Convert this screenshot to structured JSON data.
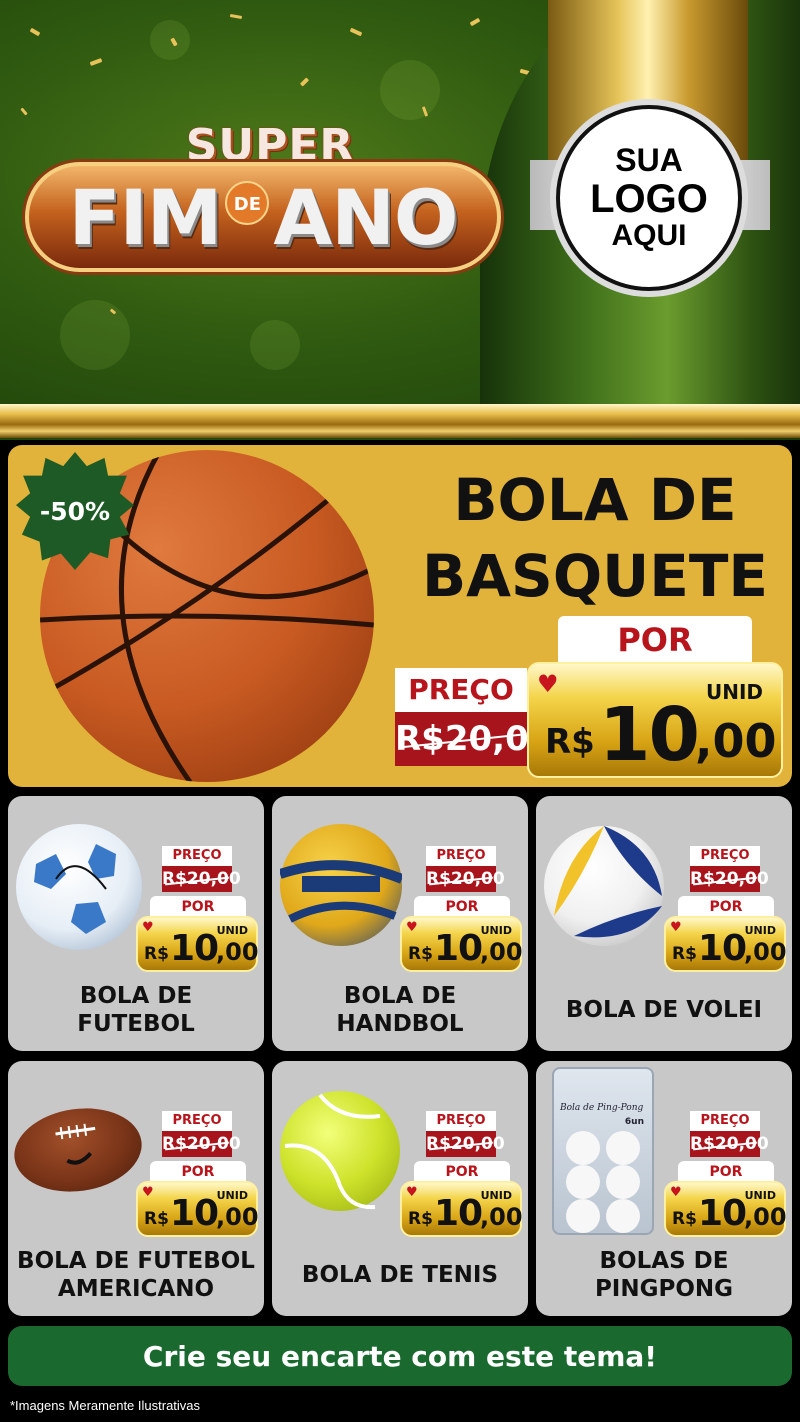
{
  "header": {
    "title_super": "SUPER",
    "title_fim": "FIM",
    "title_de": "DE",
    "title_ano": "ANO",
    "logo_line1": "SUA",
    "logo_line2": "LOGO",
    "logo_line3": "AQUI"
  },
  "featured": {
    "badge": "-50%",
    "name_line1": "BOLA DE",
    "name_line2": "BASQUETE",
    "por_label": "POR",
    "preco_label": "PREÇO",
    "old_price": "R$20,00",
    "unit": "UNID",
    "currency": "R$",
    "price_int": "10",
    "price_dec": ",00"
  },
  "products": [
    {
      "name_line1": "BOLA DE",
      "name_line2": "FUTEBOL",
      "image": "soccer-ball",
      "preco_label": "PREÇO",
      "old_price": "R$20,00",
      "por_label": "POR",
      "unit": "UNID",
      "currency": "R$",
      "price_int": "10",
      "price_dec": ",00"
    },
    {
      "name_line1": "BOLA DE",
      "name_line2": "HANDBOL",
      "image": "handball",
      "preco_label": "PREÇO",
      "old_price": "R$20,00",
      "por_label": "POR",
      "unit": "UNID",
      "currency": "R$",
      "price_int": "10",
      "price_dec": ",00"
    },
    {
      "name_line1": "BOLA DE VOLEI",
      "name_line2": "",
      "image": "volleyball",
      "preco_label": "PREÇO",
      "old_price": "R$20,00",
      "por_label": "POR",
      "unit": "UNID",
      "currency": "R$",
      "price_int": "10",
      "price_dec": ",00"
    },
    {
      "name_line1": "BOLA DE FUTEBOL",
      "name_line2": "AMERICANO",
      "image": "american-football",
      "preco_label": "PREÇO",
      "old_price": "R$20,00",
      "por_label": "POR",
      "unit": "UNID",
      "currency": "R$",
      "price_int": "10",
      "price_dec": ",00"
    },
    {
      "name_line1": "BOLA DE TENIS",
      "name_line2": "",
      "image": "tennis-ball",
      "preco_label": "PREÇO",
      "old_price": "R$20,00",
      "por_label": "POR",
      "unit": "UNID",
      "currency": "R$",
      "price_int": "10",
      "price_dec": ",00"
    },
    {
      "name_line1": "BOLAS DE",
      "name_line2": "PINGPONG",
      "image": "pingpong-balls-pack",
      "pack_label": "Bola de Ping-Pong",
      "pack_count": "6un",
      "preco_label": "PREÇO",
      "old_price": "R$20,00",
      "por_label": "POR",
      "unit": "UNID",
      "currency": "R$",
      "price_int": "10",
      "price_dec": ",00"
    }
  ],
  "cta": {
    "label": "Crie seu encarte com este tema!"
  },
  "footer": {
    "disclaimer": "*Imagens Meramente Ilustrativas"
  },
  "colors": {
    "green": "#1a6a30",
    "gold": "#e2b33b",
    "red": "#a8141c",
    "card": "#c8c8c8"
  }
}
